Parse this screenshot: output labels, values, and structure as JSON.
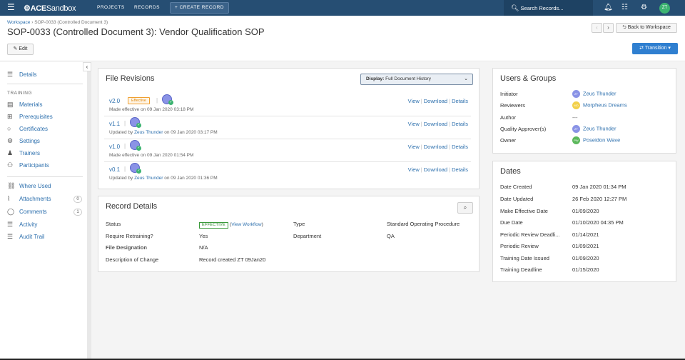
{
  "topbar": {
    "logo_main": "ACE",
    "logo_sub": "Sandbox",
    "nav": [
      "PROJECTS",
      "RECORDS"
    ],
    "create_label": "+ CREATE RECORD",
    "search_placeholder": "Search Records...",
    "avatar_initials": "ZT"
  },
  "header": {
    "breadcrumb_root": "Workspace",
    "breadcrumb_sep": "›",
    "breadcrumb_current": "SOP-0033 (Controlled Document 3)",
    "title": "SOP-0033 (Controlled Document 3): Vendor Qualification SOP",
    "edit_label": "Edit",
    "back_label": "Back to Workspace",
    "transition_label": "Transition"
  },
  "sidebar": {
    "details": "Details",
    "training_heading": "TRAINING",
    "training_items": [
      "Materials",
      "Prerequisites",
      "Certificates",
      "Settings",
      "Trainers",
      "Participants"
    ],
    "other_items": [
      "Where Used",
      "Attachments",
      "Comments",
      "Activity",
      "Audit Trail"
    ],
    "attachments_count": "0",
    "comments_count": "1"
  },
  "file_revisions": {
    "title": "File Revisions",
    "display_label": "Display:",
    "display_value": "Full Document History",
    "actions": {
      "view": "View",
      "download": "Download",
      "details": "Details",
      "sep": "|"
    },
    "rows": [
      {
        "version": "v2.0",
        "badge": "Effective",
        "note_prefix": "Made effective on 09 Jan 2020 03:18 PM",
        "note_user": "",
        "note_suffix": ""
      },
      {
        "version": "v1.1",
        "badge": "",
        "note_prefix": "Updated by ",
        "note_user": "Zeus Thunder",
        "note_suffix": " on 09 Jan 2020 03:17 PM"
      },
      {
        "version": "v1.0",
        "badge": "",
        "note_prefix": "Made effective on 09 Jan 2020 01:54 PM",
        "note_user": "",
        "note_suffix": ""
      },
      {
        "version": "v0.1",
        "badge": "",
        "note_prefix": "Updated by ",
        "note_user": "Zeus Thunder",
        "note_suffix": " on 09 Jan 2020 01:36 PM"
      }
    ]
  },
  "record_details": {
    "title": "Record Details",
    "status_label": "Status",
    "status_value": "EFFECTIVE",
    "view_workflow": "View Workflow",
    "require_retraining_label": "Require Retraining?",
    "require_retraining_value": "Yes",
    "file_designation_label": "File Designation",
    "file_designation_value": "N/A",
    "description_label": "Description of Change",
    "description_value": "Record created ZT 09Jan20",
    "type_label": "Type",
    "type_value": "Standard Operating Procedure",
    "department_label": "Department",
    "department_value": "QA"
  },
  "users_groups": {
    "title": "Users & Groups",
    "rows": [
      {
        "label": "Initiator",
        "value": "Zeus Thunder",
        "avatar": "ZT",
        "color": "#8a93e6"
      },
      {
        "label": "Reviewers",
        "value": "Morpheus Dreams",
        "avatar": "MD",
        "color": "#f2d04a"
      },
      {
        "label": "Author",
        "value": "---",
        "avatar": "",
        "color": ""
      },
      {
        "label": "Quality Approver(s)",
        "value": "Zeus Thunder",
        "avatar": "ZT",
        "color": "#8a93e6"
      },
      {
        "label": "Owner",
        "value": "Poseidon Wave",
        "avatar": "PW",
        "color": "#5cb85c"
      }
    ]
  },
  "dates": {
    "title": "Dates",
    "rows": [
      {
        "label": "Date Created",
        "value": "09 Jan 2020 01:34 PM"
      },
      {
        "label": "Date Updated",
        "value": "26 Feb 2020 12:27 PM"
      },
      {
        "label": "Make Effective Date",
        "value": "01/09/2020"
      },
      {
        "label": "Due Date",
        "value": "01/10/2020 04:35 PM"
      },
      {
        "label": "Periodic Review Deadli...",
        "value": "01/14/2021"
      },
      {
        "label": "Periodic Review",
        "value": "01/09/2021"
      },
      {
        "label": "Training Date Issued",
        "value": "01/09/2020"
      },
      {
        "label": "Training Deadline",
        "value": "01/15/2020"
      }
    ]
  },
  "colors": {
    "topbar": "#264e73",
    "link": "#2c6fad",
    "primary_button": "#2f7fd0",
    "effective": "#e08a10"
  }
}
